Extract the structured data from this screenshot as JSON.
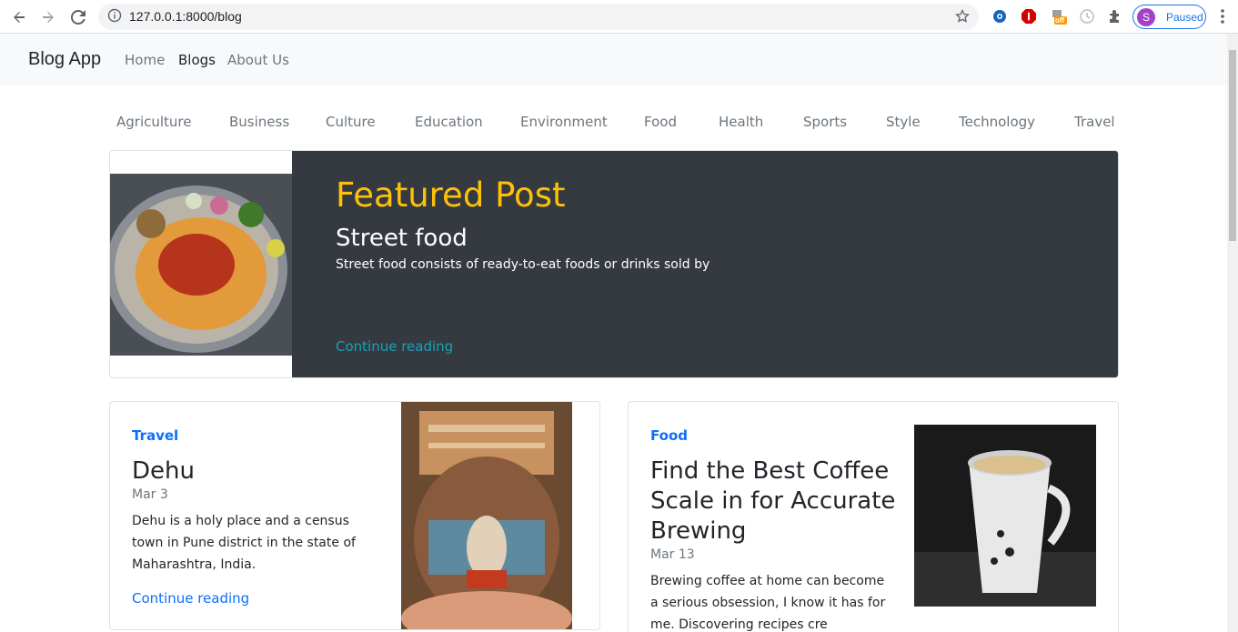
{
  "browser": {
    "url": "127.0.0.1:8000/blog",
    "profile_initial": "S",
    "profile_status": "Paused",
    "extension_badge": "off"
  },
  "navbar": {
    "brand": "Blog App",
    "links": [
      "Home",
      "Blogs",
      "About Us"
    ]
  },
  "categories": [
    "Agriculture",
    "Business",
    "Culture",
    "Education",
    "Environment",
    "Food",
    "Health",
    "Sports",
    "Style",
    "Technology",
    "Travel"
  ],
  "featured": {
    "heading": "Featured Post",
    "title": "Street food",
    "excerpt": "Street food consists of ready-to-eat foods or drinks sold by",
    "link": "Continue reading"
  },
  "posts": [
    {
      "category": "Travel",
      "title": "Dehu",
      "date": "Mar 3",
      "excerpt_lines": [
        "Dehu is a holy place and a census",
        "town in Pune district in the state of",
        "Maharashtra, India."
      ],
      "link": "Continue reading"
    },
    {
      "category": "Food",
      "title_lines": [
        "Find the Best Coffee",
        "Scale in for Accurate",
        "Brewing"
      ],
      "date": "Mar 13",
      "excerpt_lines": [
        "Brewing coffee at home can become",
        "a serious obsession, I know it has for",
        "me. Discovering recipes cre"
      ]
    }
  ],
  "colors": {
    "accent": "#ffc107",
    "link": "#0d6efd",
    "featured_link": "#17a2b8",
    "featured_bg": "#343a40",
    "navbar_bg": "#f8f9fa"
  }
}
